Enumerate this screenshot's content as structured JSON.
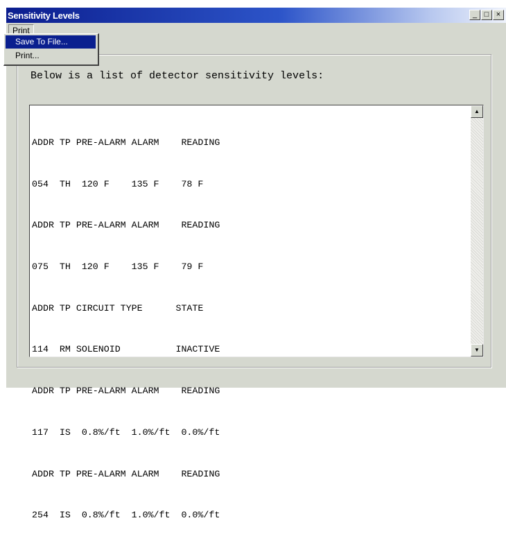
{
  "window": {
    "title": "Sensitivity Levels",
    "controls": {
      "minimize": "_",
      "maximize": "□",
      "close": "×"
    }
  },
  "menubar": {
    "print_menu_label": "Print"
  },
  "dropdown": {
    "items": [
      {
        "label": "Save To File..."
      },
      {
        "label": "Print..."
      }
    ]
  },
  "main": {
    "heading": "Below is a list of detector sensitivity levels:",
    "lines": [
      "ADDR TP PRE-ALARM ALARM    READING",
      "054  TH  120 F    135 F    78 F",
      "ADDR TP PRE-ALARM ALARM    READING",
      "075  TH  120 F    135 F    79 F",
      "ADDR TP CIRCUIT TYPE      STATE",
      "114  RM SOLENOID          INACTIVE",
      "ADDR TP PRE-ALARM ALARM    READING",
      "117  IS  0.8%/ft  1.0%/ft  0.0%/ft",
      "ADDR TP PRE-ALARM ALARM    READING",
      "254  IS  0.8%/ft  1.0%/ft  0.0%/ft"
    ]
  },
  "scrollbar": {
    "up_icon": "▲",
    "down_icon": "▼"
  }
}
